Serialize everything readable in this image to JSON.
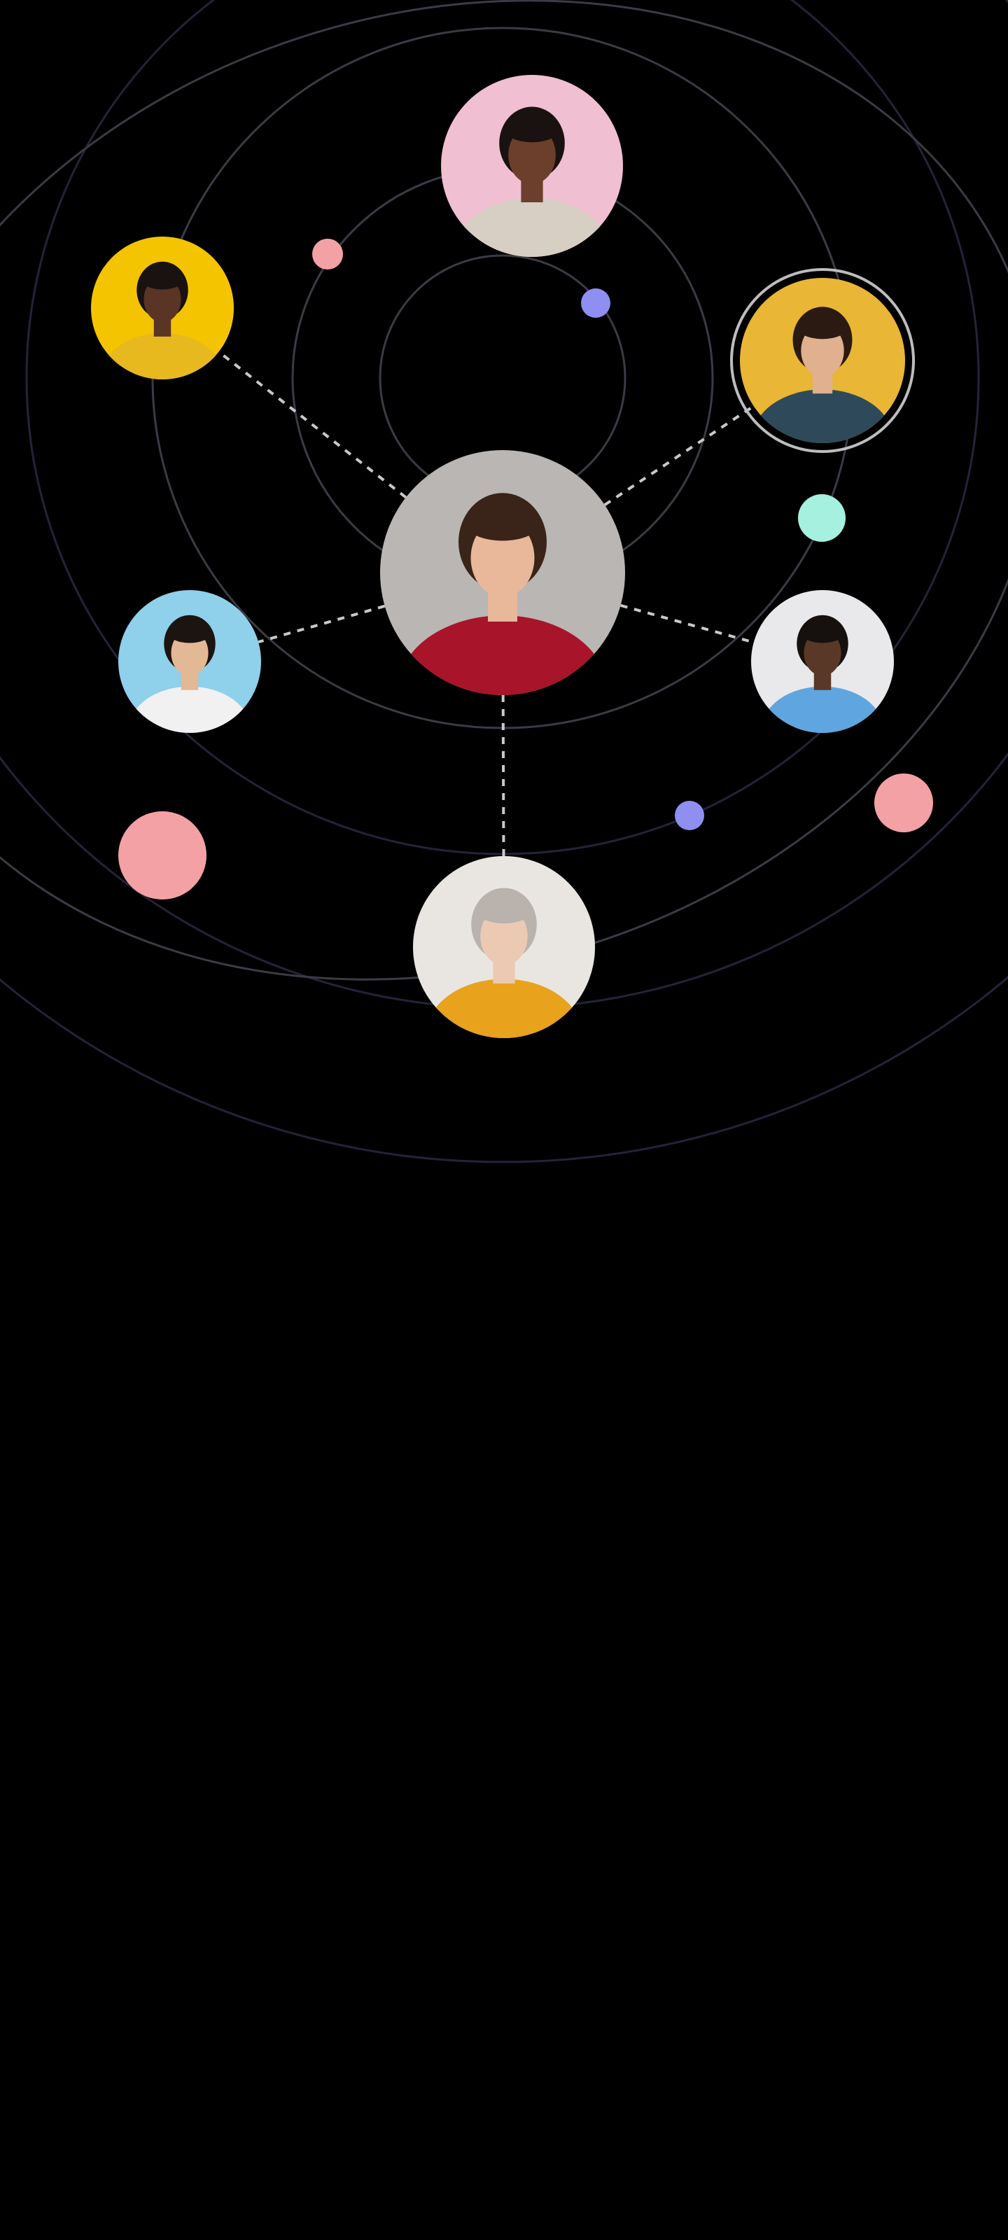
{
  "theme": {
    "background": "#000000",
    "orbit_ring_color": "#3b3b45",
    "orbit_ring_outer_color": "#23233a",
    "connector_color": "#c9c9c9"
  },
  "center_avatar": {
    "name": "avatar-center-woman-red-sweater",
    "bg": "#b9b6b3",
    "skin": "#e9b79a",
    "hair": "#3a2318",
    "clothing": "#a8142a"
  },
  "avatars": [
    {
      "name": "avatar-woman-pink-background",
      "bg": "#f0bfd1",
      "skin": "#6b3f2b",
      "hair": "#1a1210",
      "clothing": "#d8cfc4",
      "connected": false,
      "ring": false
    },
    {
      "name": "avatar-woman-red-yellow-background",
      "bg": "#f5c400",
      "skin": "#5a3424",
      "hair": "#181210",
      "clothing": "#e8b81f",
      "connected": true,
      "ring": false
    },
    {
      "name": "avatar-woman-mustard-background",
      "bg": "#e9b635",
      "skin": "#e0b08f",
      "hair": "#2a1a12",
      "clothing": "#2e4a5a",
      "connected": true,
      "ring": true
    },
    {
      "name": "avatar-man-blue-background",
      "bg": "#8fd0ea",
      "skin": "#e3b894",
      "hair": "#1c1410",
      "clothing": "#f1f1f1",
      "connected": true,
      "ring": false
    },
    {
      "name": "avatar-man-light-background",
      "bg": "#e9e9ec",
      "skin": "#5a3828",
      "hair": "#16110e",
      "clothing": "#5fa6e0",
      "connected": true,
      "ring": false
    },
    {
      "name": "avatar-older-woman-yellow-sweater",
      "bg": "#e9e6e2",
      "skin": "#ecc9b3",
      "hair": "#b9b2ad",
      "clothing": "#e8a21c",
      "connected": true,
      "ring": false
    }
  ],
  "decor_dots": [
    {
      "name": "pink-dot-small",
      "color": "#f4a1a5"
    },
    {
      "name": "violet-dot-small",
      "color": "#8f8ff2"
    },
    {
      "name": "mint-dot",
      "color": "#a5f0df"
    },
    {
      "name": "violet-dot-lower",
      "color": "#8f8ff2"
    },
    {
      "name": "pink-dot-large-left",
      "color": "#f4a1a5"
    },
    {
      "name": "pink-dot-large-right",
      "color": "#f4a1a5"
    }
  ]
}
